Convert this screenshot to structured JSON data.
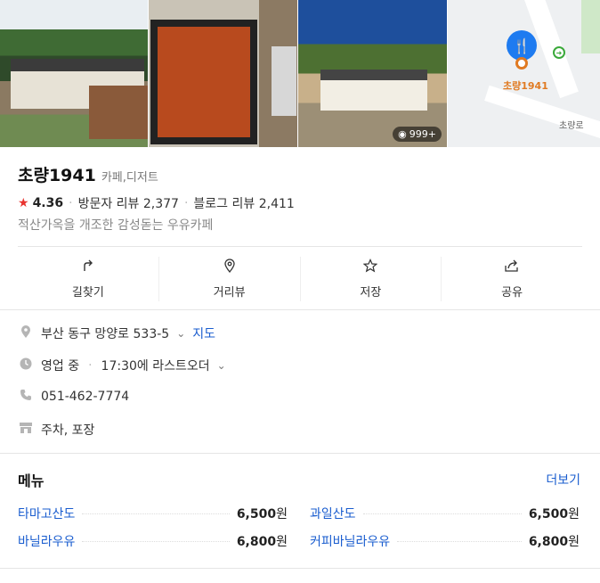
{
  "photos": {
    "count_badge": "999+",
    "map_pin_label": "초량1941",
    "map_road_label": "초량로"
  },
  "place": {
    "name": "초량1941",
    "category": "카페,디저트",
    "rating": "4.36",
    "visitor_reviews": "방문자 리뷰 2,377",
    "blog_reviews": "블로그 리뷰 2,411",
    "description": "적산가옥을 개조한 감성돋는 우유카페"
  },
  "actions": [
    {
      "label": "길찾기",
      "icon": "directions-icon"
    },
    {
      "label": "거리뷰",
      "icon": "streetview-icon"
    },
    {
      "label": "저장",
      "icon": "star-icon"
    },
    {
      "label": "공유",
      "icon": "share-icon"
    }
  ],
  "info": {
    "address": "부산 동구 망양로 533-5",
    "map_link": "지도",
    "status": "영업 중",
    "hours": "17:30에 라스트오더",
    "phone": "051-462-7774",
    "amenities": "주차, 포장"
  },
  "menu": {
    "title": "메뉴",
    "more": "더보기",
    "items": [
      {
        "name": "타마고산도",
        "price": "6,500",
        "unit": "원"
      },
      {
        "name": "과일산도",
        "price": "6,500",
        "unit": "원"
      },
      {
        "name": "바닐라우유",
        "price": "6,800",
        "unit": "원"
      },
      {
        "name": "커피바닐라우유",
        "price": "6,800",
        "unit": "원"
      }
    ]
  },
  "colors": {
    "accent_link": "#1a5dcf",
    "star": "#e8332f",
    "map_pin": "#1e7bf0",
    "map_label": "#e07a22"
  }
}
